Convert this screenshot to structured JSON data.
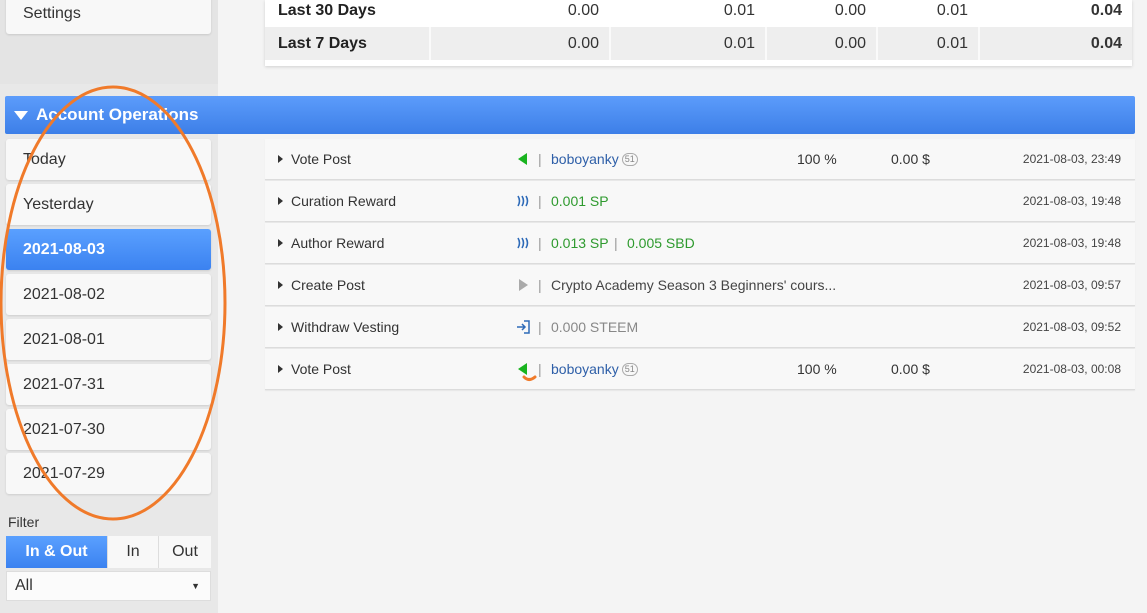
{
  "sidebar": {
    "settings_label": "Settings",
    "dates": [
      "Today",
      "Yesterday",
      "2021-08-03",
      "2021-08-02",
      "2021-08-01",
      "2021-07-31",
      "2021-07-30",
      "2021-07-29"
    ],
    "active_index": 2
  },
  "summary": {
    "rows": [
      {
        "label": "Last 30 Days",
        "v1": "0.00",
        "v2": "0.01",
        "v3": "0.00",
        "v4": "0.01",
        "v5": "0.04"
      },
      {
        "label": "Last 7 Days",
        "v1": "0.00",
        "v2": "0.01",
        "v3": "0.00",
        "v4": "0.01",
        "v5": "0.04"
      }
    ]
  },
  "ops_header": {
    "title": "Account Operations"
  },
  "operations": [
    {
      "type": "Vote Post",
      "icon": "vote-icon",
      "user": "boboyanky",
      "rep": "51",
      "pct": "100 %",
      "usd": "0.00 $",
      "date": "2021-08-03, 23:49"
    },
    {
      "type": "Curation Reward",
      "icon": "steem-icon",
      "amount1": "0.001 SP",
      "date": "2021-08-03, 19:48"
    },
    {
      "type": "Author Reward",
      "icon": "steem-icon",
      "amount1": "0.013 SP",
      "amount2": "0.005 SBD",
      "date": "2021-08-03, 19:48"
    },
    {
      "type": "Create Post",
      "icon": "play-icon",
      "title": "Crypto Academy Season 3 Beginners' cours...",
      "date": "2021-08-03, 09:57"
    },
    {
      "type": "Withdraw Vesting",
      "icon": "withdraw-icon",
      "amount1": "0.000 STEEM",
      "date": "2021-08-03, 09:52"
    },
    {
      "type": "Vote Post",
      "icon": "vote-icon",
      "user": "boboyanky",
      "rep": "51",
      "pct": "100 %",
      "usd": "0.00 $",
      "date": "2021-08-03, 00:08"
    }
  ],
  "filter": {
    "label": "Filter",
    "options": [
      "In & Out",
      "In",
      "Out"
    ],
    "active": "In & Out",
    "select_value": "All"
  },
  "colors": {
    "accent": "#3d7fe8",
    "green": "#2e9a2e",
    "link": "#2e5fa8",
    "annotation": "#f07a2a"
  }
}
